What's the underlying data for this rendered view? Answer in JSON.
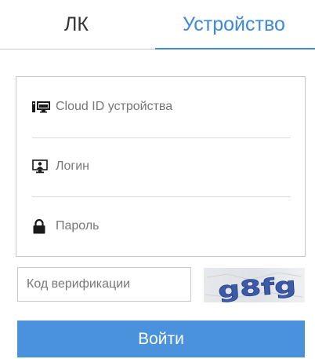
{
  "tabs": {
    "items": [
      {
        "label": "ЛК",
        "active": false
      },
      {
        "label": "Устройство",
        "active": true
      }
    ]
  },
  "form": {
    "fields": [
      {
        "icon": "device-icon",
        "placeholder": "Cloud ID устройства"
      },
      {
        "icon": "monitor-user-icon",
        "placeholder": "Логин"
      },
      {
        "icon": "lock-icon",
        "placeholder": "Пароль"
      }
    ]
  },
  "verification": {
    "placeholder": "Код верификации",
    "captcha_text": "g8fg"
  },
  "login_button": {
    "label": "Войти"
  },
  "colors": {
    "accent": "#3d88d8",
    "button": "#4a93dc",
    "border": "#c9c9c9"
  }
}
